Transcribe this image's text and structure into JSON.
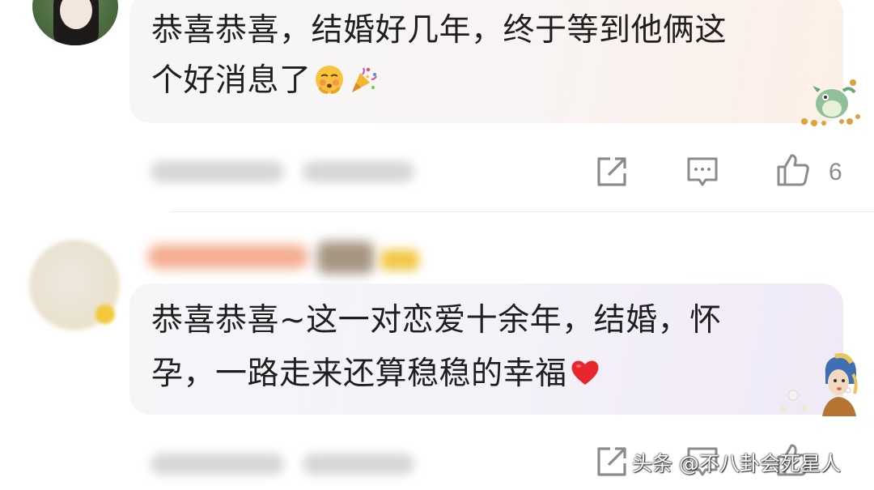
{
  "comments": [
    {
      "text_line1": "恭喜恭喜，结婚好几年，终于等到他俩这",
      "text_line2": "个好消息了",
      "emojis": [
        "blushing-face-icon",
        "party-popper-icon"
      ],
      "like_count": "6",
      "bubble_sticker": "dragon-sticker-icon"
    },
    {
      "text_line1": "恭喜恭喜~这一对恋爱十余年，结婚，怀",
      "text_line2": "孕，一路走来还算稳稳的幸福",
      "emojis": [
        "red-heart-icon"
      ],
      "bubble_sticker": "pearl-earring-girl-sticker-icon"
    }
  ],
  "actions": [
    "share-icon",
    "reply-icon",
    "like-icon"
  ],
  "watermark": "头条 @不八卦会死星人",
  "colors": {
    "text": "#1f1f1f",
    "icon": "#8b8b8b",
    "bubble1_tint": "#fcefe6",
    "bubble2_tint": "#efe9f7"
  }
}
